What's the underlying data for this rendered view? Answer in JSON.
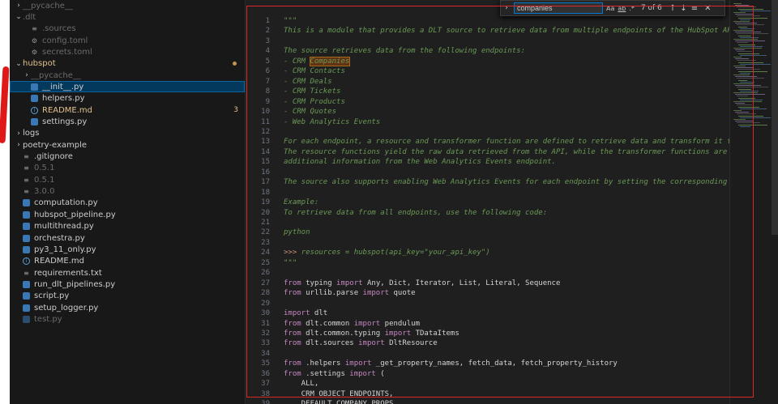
{
  "explorer": {
    "items": [
      {
        "label": "__pycache__",
        "type": "folder",
        "collapsed": true,
        "indent": 1,
        "dim": true
      },
      {
        "label": ".dlt",
        "type": "folder",
        "collapsed": false,
        "indent": 1,
        "dim": true
      },
      {
        "label": ".sources",
        "type": "txt",
        "indent": 2,
        "dim": true
      },
      {
        "label": "config.toml",
        "type": "toml",
        "indent": 2,
        "dim": true
      },
      {
        "label": "secrets.toml",
        "type": "toml",
        "indent": 2,
        "dim": true
      },
      {
        "label": "hubspot",
        "type": "folder",
        "collapsed": false,
        "indent": 1,
        "color": "yellow",
        "dot": true
      },
      {
        "label": "__pycache__",
        "type": "folder",
        "collapsed": true,
        "indent": 2,
        "dim": true
      },
      {
        "label": "__init__.py",
        "type": "py",
        "indent": 2,
        "selected": true
      },
      {
        "label": "helpers.py",
        "type": "py",
        "indent": 2
      },
      {
        "label": "README.md",
        "type": "info",
        "indent": 2,
        "color": "yellow",
        "badge": "3"
      },
      {
        "label": "settings.py",
        "type": "py",
        "indent": 2
      },
      {
        "label": "logs",
        "type": "folder",
        "collapsed": true,
        "indent": 1
      },
      {
        "label": "poetry-example",
        "type": "folder",
        "collapsed": true,
        "indent": 1
      },
      {
        "label": ".gitignore",
        "type": "txt",
        "indent": 1
      },
      {
        "label": "0.5.1",
        "type": "txt",
        "indent": 1,
        "dim": true
      },
      {
        "label": "0.5.1",
        "type": "txt",
        "indent": 1,
        "dim": true
      },
      {
        "label": "3.0.0",
        "type": "txt",
        "indent": 1,
        "dim": true
      },
      {
        "label": "computation.py",
        "type": "py",
        "indent": 1
      },
      {
        "label": "hubspot_pipeline.py",
        "type": "py",
        "indent": 1
      },
      {
        "label": "multithread.py",
        "type": "py",
        "indent": 1
      },
      {
        "label": "orchestra.py",
        "type": "py",
        "indent": 1
      },
      {
        "label": "py3_11_only.py",
        "type": "py",
        "indent": 1
      },
      {
        "label": "README.md",
        "type": "info",
        "indent": 1
      },
      {
        "label": "requirements.txt",
        "type": "txt",
        "indent": 1
      },
      {
        "label": "run_dlt_pipelines.py",
        "type": "py",
        "indent": 1
      },
      {
        "label": "script.py",
        "type": "py",
        "indent": 1
      },
      {
        "label": "setup_logger.py",
        "type": "py",
        "indent": 1
      },
      {
        "label": "test.py",
        "type": "py",
        "indent": 1,
        "dim": true
      }
    ]
  },
  "find_widget": {
    "query": "companies",
    "match_case_label": "Aa",
    "whole_word_label": "ab",
    "regex_label": ".*",
    "match_count": "7 of 6"
  },
  "editor": {
    "lines": [
      {
        "n": "1",
        "tokens": [
          {
            "t": "\"\"\"",
            "c": "doc"
          }
        ]
      },
      {
        "n": "2",
        "tokens": [
          {
            "t": "This is a module that provides a DLT source to retrieve data from multiple endpoints of the HubSpot API using",
            "c": "doc"
          }
        ]
      },
      {
        "n": "3",
        "tokens": []
      },
      {
        "n": "4",
        "tokens": [
          {
            "t": "The source retrieves data from the following endpoints:",
            "c": "doc"
          }
        ]
      },
      {
        "n": "5",
        "tokens": [
          {
            "t": "- CRM ",
            "c": "doc"
          },
          {
            "t": "Companies",
            "c": "doc hl"
          }
        ]
      },
      {
        "n": "6",
        "tokens": [
          {
            "t": "- CRM Contacts",
            "c": "doc"
          }
        ]
      },
      {
        "n": "7",
        "tokens": [
          {
            "t": "- CRM Deals",
            "c": "doc"
          }
        ]
      },
      {
        "n": "8",
        "tokens": [
          {
            "t": "- CRM Tickets",
            "c": "doc"
          }
        ]
      },
      {
        "n": "9",
        "tokens": [
          {
            "t": "- CRM Products",
            "c": "doc"
          }
        ]
      },
      {
        "n": "10",
        "tokens": [
          {
            "t": "- CRM Quotes",
            "c": "doc"
          }
        ]
      },
      {
        "n": "11",
        "tokens": [
          {
            "t": "- Web Analytics Events",
            "c": "doc"
          }
        ]
      },
      {
        "n": "12",
        "tokens": []
      },
      {
        "n": "13",
        "tokens": [
          {
            "t": "For each endpoint, a resource and transformer function are defined to retrieve data and transform it to a com",
            "c": "doc"
          }
        ]
      },
      {
        "n": "14",
        "tokens": [
          {
            "t": "The resource functions yield the raw data retrieved from the API, while the transformer functions are used to",
            "c": "doc"
          }
        ]
      },
      {
        "n": "15",
        "tokens": [
          {
            "t": "additional information from the Web Analytics Events endpoint.",
            "c": "doc"
          }
        ]
      },
      {
        "n": "16",
        "tokens": []
      },
      {
        "n": "17",
        "tokens": [
          {
            "t": "The source also supports enabling Web Analytics Events for each endpoint by setting the corresponding enable_",
            "c": "doc"
          }
        ]
      },
      {
        "n": "18",
        "tokens": []
      },
      {
        "n": "19",
        "tokens": [
          {
            "t": "Example:",
            "c": "doc"
          }
        ]
      },
      {
        "n": "20",
        "tokens": [
          {
            "t": "To retrieve data from all endpoints, use the following code:",
            "c": "doc"
          }
        ]
      },
      {
        "n": "21",
        "tokens": []
      },
      {
        "n": "22",
        "tokens": [
          {
            "t": "python",
            "c": "doc"
          }
        ]
      },
      {
        "n": "23",
        "tokens": []
      },
      {
        "n": "24",
        "tokens": [
          {
            "t": ">>> ",
            "c": "prompt"
          },
          {
            "t": "resources = hubspot(api_key=\"your_api_key\")",
            "c": "doc"
          }
        ]
      },
      {
        "n": "25",
        "tokens": [
          {
            "t": "\"\"\"",
            "c": "doc"
          }
        ]
      },
      {
        "n": "26",
        "tokens": []
      },
      {
        "n": "27",
        "tokens": [
          {
            "t": "from",
            "c": "kw"
          },
          {
            "t": " typing ",
            "c": "plain"
          },
          {
            "t": "import",
            "c": "kw"
          },
          {
            "t": " Any, Dict, Iterator, List, Literal, Sequence",
            "c": "plain"
          }
        ]
      },
      {
        "n": "28",
        "tokens": [
          {
            "t": "from",
            "c": "kw"
          },
          {
            "t": " urllib.parse ",
            "c": "plain"
          },
          {
            "t": "import",
            "c": "kw"
          },
          {
            "t": " quote",
            "c": "plain"
          }
        ]
      },
      {
        "n": "29",
        "tokens": []
      },
      {
        "n": "30",
        "tokens": [
          {
            "t": "import",
            "c": "kw"
          },
          {
            "t": " dlt",
            "c": "plain"
          }
        ]
      },
      {
        "n": "31",
        "tokens": [
          {
            "t": "from",
            "c": "kw"
          },
          {
            "t": " dlt.common ",
            "c": "plain"
          },
          {
            "t": "import",
            "c": "kw"
          },
          {
            "t": " pendulum",
            "c": "plain"
          }
        ]
      },
      {
        "n": "32",
        "tokens": [
          {
            "t": "from",
            "c": "kw"
          },
          {
            "t": " dlt.common.typing ",
            "c": "plain"
          },
          {
            "t": "import",
            "c": "kw"
          },
          {
            "t": " TDataItems",
            "c": "plain"
          }
        ]
      },
      {
        "n": "33",
        "tokens": [
          {
            "t": "from",
            "c": "kw"
          },
          {
            "t": " dlt.sources ",
            "c": "plain"
          },
          {
            "t": "import",
            "c": "kw"
          },
          {
            "t": " DltResource",
            "c": "plain"
          }
        ]
      },
      {
        "n": "34",
        "tokens": []
      },
      {
        "n": "35",
        "tokens": [
          {
            "t": "from",
            "c": "kw"
          },
          {
            "t": " .helpers ",
            "c": "plain"
          },
          {
            "t": "import",
            "c": "kw"
          },
          {
            "t": " _get_property_names, fetch_data, fetch_property_history",
            "c": "plain"
          }
        ]
      },
      {
        "n": "36",
        "tokens": [
          {
            "t": "from",
            "c": "kw"
          },
          {
            "t": " .settings ",
            "c": "plain"
          },
          {
            "t": "import",
            "c": "kw"
          },
          {
            "t": " (",
            "c": "plain"
          }
        ]
      },
      {
        "n": "37",
        "tokens": [
          {
            "t": "    ALL,",
            "c": "plain"
          }
        ]
      },
      {
        "n": "38",
        "tokens": [
          {
            "t": "    CRM_OBJECT_ENDPOINTS,",
            "c": "plain"
          }
        ]
      },
      {
        "n": "39",
        "tokens": [
          {
            "t": "    DEFAULT_COMPANY_PROPS,",
            "c": "plain"
          }
        ]
      }
    ]
  },
  "colors": {
    "accent_selection": "#04395e",
    "annotation_red": "#d8282a",
    "docstring": "#6a9955",
    "keyword": "#c586c0",
    "match_highlight": "#613214"
  }
}
